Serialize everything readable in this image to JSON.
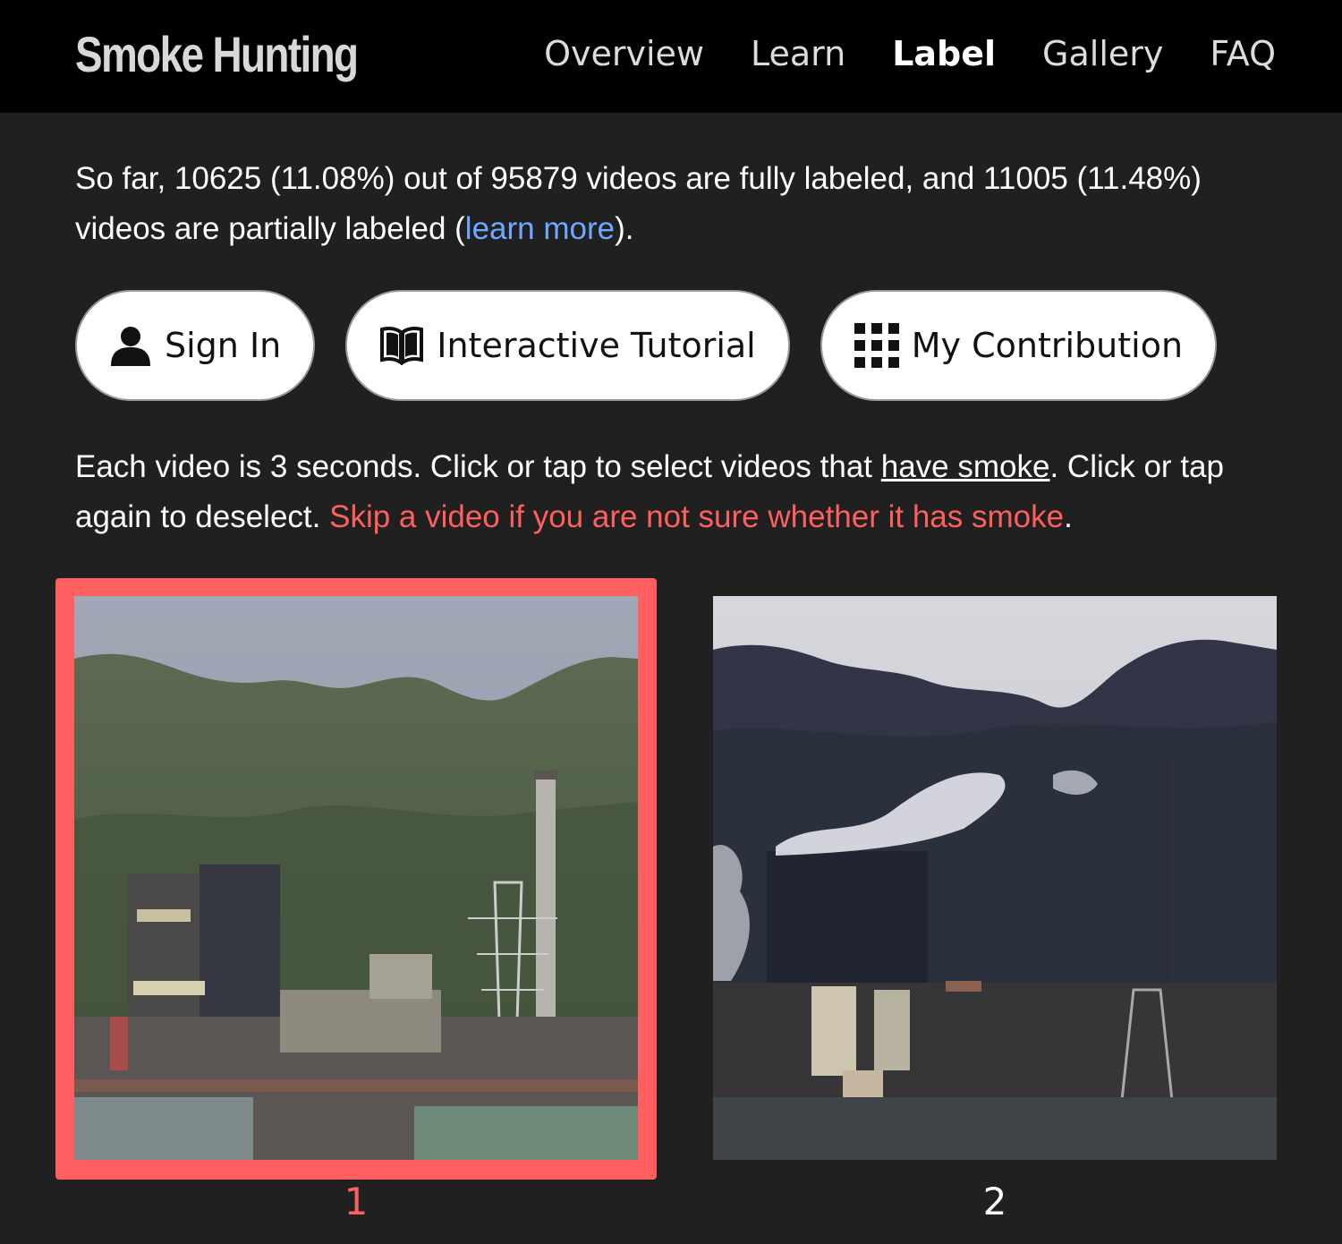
{
  "header": {
    "brand": "Smoke Hunting",
    "nav": [
      {
        "label": "Overview",
        "active": false
      },
      {
        "label": "Learn",
        "active": false
      },
      {
        "label": "Label",
        "active": true
      },
      {
        "label": "Gallery",
        "active": false
      },
      {
        "label": "FAQ",
        "active": false
      }
    ]
  },
  "stats": {
    "text_before": "So far, 10625 (11.08%) out of 95879 videos are fully labeled, and 11005 (11.48%) videos are partially labeled (",
    "link": "learn more",
    "text_after": ")."
  },
  "buttons": {
    "sign_in": {
      "label": "Sign In",
      "icon": "user-icon"
    },
    "tutorial": {
      "label": "Interactive Tutorial",
      "icon": "book-icon"
    },
    "contribution": {
      "label": "My Contribution",
      "icon": "grid-icon"
    }
  },
  "instructions": {
    "part1": "Each video is 3 seconds. Click or tap to select videos that ",
    "underlined": "have smoke",
    "part2": ". Click or tap again to deselect. ",
    "warning": "Skip a video if you are not sure whether it has smoke",
    "part3": "."
  },
  "videos": [
    {
      "number": "1",
      "selected": true
    },
    {
      "number": "2",
      "selected": false
    }
  ],
  "colors": {
    "background": "#202020",
    "topbar": "#000000",
    "link": "#6ea8ff",
    "selected": "#ff5f5f"
  }
}
